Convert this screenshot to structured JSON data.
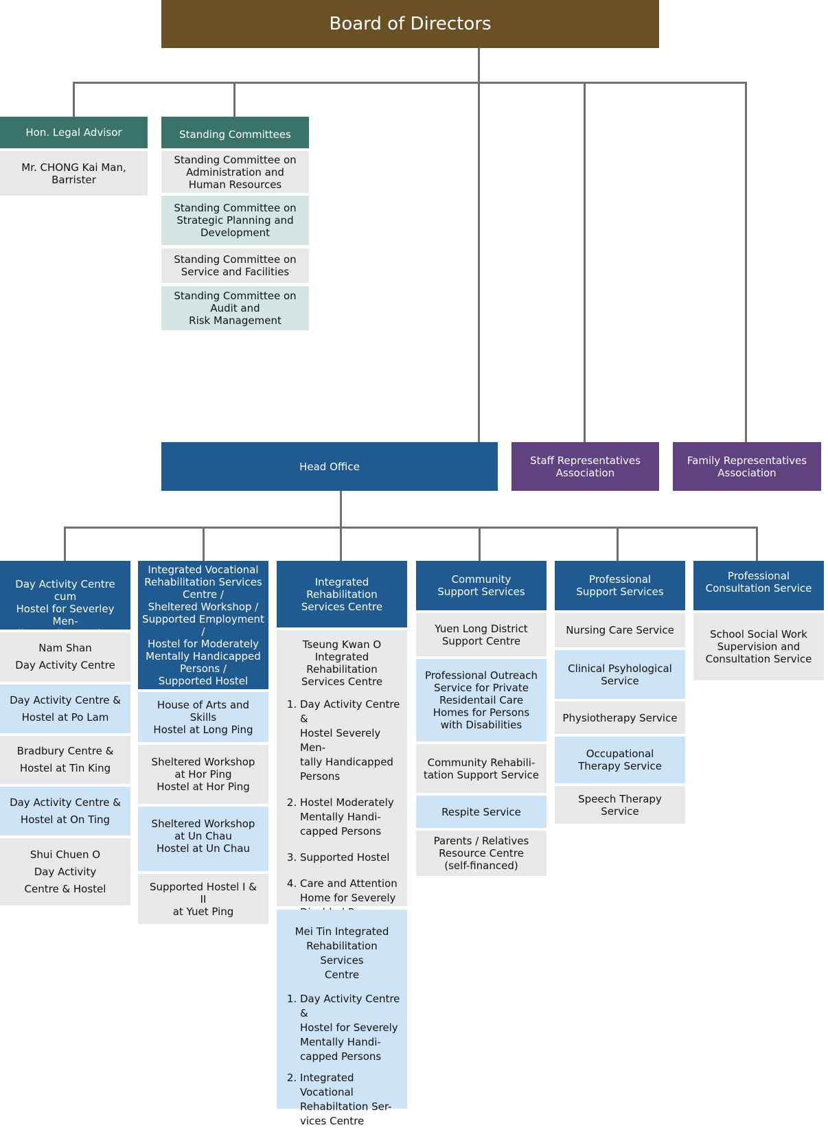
{
  "board": {
    "title": "Board of Directors"
  },
  "legal": {
    "title": "Hon. Legal Advisor",
    "person": "Mr. CHONG Kai Man,\nBarrister"
  },
  "committees": {
    "title": "Standing Committees",
    "items": [
      "Standing Committee on\nAdministration and\nHuman Resources",
      "Standing Committee on\nStrategic Planning and\nDevelopment",
      "Standing Committee on\nService and Facilities",
      "Standing Committee on\nAudit and\nRisk Management"
    ]
  },
  "head_office": {
    "title": "Head Office"
  },
  "staff_assoc": {
    "title": "Staff Representatives\nAssociation"
  },
  "family_assoc": {
    "title": "Family Representatives\nAssociation"
  },
  "divisions": [
    {
      "title": "Day Activity Centre cum\nHostel for Severley Men-\ntally Handicapped Per-",
      "items": [
        "Nam Shan\nDay Activity Centre",
        "Day Activity Centre &\nHostel at Po Lam",
        "Bradbury Centre &\nHostel at Tin King",
        "Day Activity Centre &\nHostel at On Ting",
        "Shui Chuen O\nDay Activity\nCentre & Hostel"
      ]
    },
    {
      "title": "Integrated Vocational\nRehabilitation Services\nCentre /\nSheltered Workshop /\nSupported Employment\n/\nHostel for Moderately\nMentally Handicapped\nPersons /\nSupported Hostel",
      "items": [
        "House of Arts and\nSkills\nHostel at Long Ping",
        "Sheltered Workshop\nat Hor Ping\nHostel at Hor Ping",
        "Sheltered Workshop\nat Un Chau\nHostel at Un Chau",
        "Supported Hostel I &\nII\nat Yuet Ping"
      ]
    },
    {
      "title": "Integrated\nRehabilitation\nServices Centre",
      "centres": [
        {
          "name": "Tseung Kwan O\nIntegrated Rehabilitation\nServices Centre",
          "services": [
            "Day Activity Centre &\nHostel Severely Men-\ntally Handicapped\nPersons",
            "Hostel Moderately\nMentally Handi-\ncapped Persons",
            "Supported Hostel",
            "Care and Attention\nHome for Severely\nDisabled Persons"
          ]
        },
        {
          "name": "Mei Tin Integrated\nRehabilitation Services\nCentre",
          "services": [
            "Day Activity Centre &\nHostel for Severely\nMentally Handi-\ncapped Persons",
            "Integrated Vocational\nRehabiltation Ser-\nvices Centre"
          ]
        }
      ]
    },
    {
      "title": "Community\nSupport Services",
      "items": [
        "Yuen Long District\nSupport Centre",
        "Professional Outreach\nService for Private\nResidentail Care\nHomes for Persons\nwith Disabilities",
        "Community Rehabili-\ntation Support Service",
        "Respite Service",
        "Parents / Relatives\nResource Centre\n(self-financed)"
      ]
    },
    {
      "title": "Professional\nSupport Services",
      "items": [
        "Nursing Care Service",
        "Clinical Psyhological\nService",
        "Physiotherapy Service",
        "Occupational\nTherapy Service",
        "Speech Therapy Service"
      ]
    },
    {
      "title": "Professional\nConsultation Service",
      "items": [
        "School Social Work\nSupervision and\nConsultation Service"
      ]
    }
  ],
  "colors": {
    "board": "#6b5026",
    "committee_header": "#3a7468",
    "division_header": "#1f5b91",
    "association": "#5f427f",
    "item_grey": "#e9e9e9",
    "item_light_teal": "#d4e6e3",
    "item_light_blue": "#cde3f6",
    "connector": "#707070"
  }
}
